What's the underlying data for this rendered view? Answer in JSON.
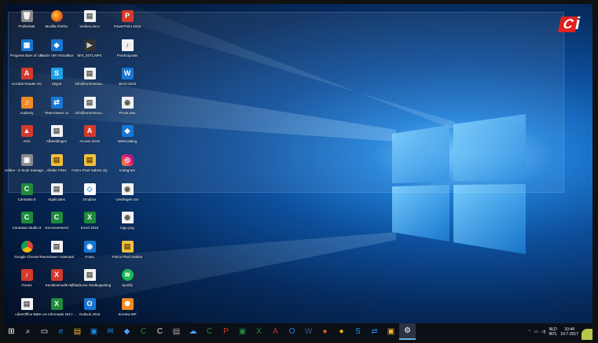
{
  "desktop": {
    "icons": [
      {
        "label": "Prullenbak",
        "glyph": "🗑",
        "cls": "g-gray"
      },
      {
        "label": "Progress Bars of Life",
        "glyph": "▦",
        "cls": "g-blue"
      },
      {
        "label": "Acrobat Reader DC",
        "glyph": "A",
        "cls": "g-red"
      },
      {
        "label": "Audacity",
        "glyph": "♫",
        "cls": "g-orange"
      },
      {
        "label": "AVG",
        "glyph": "▲",
        "cls": "g-red"
      },
      {
        "label": "calibre - E-book management",
        "glyph": "▣",
        "cls": "g-gray"
      },
      {
        "label": "Camtasia 8",
        "glyph": "C",
        "cls": "g-green"
      },
      {
        "label": "Camtasia Studio 8",
        "glyph": "C",
        "cls": "g-green"
      },
      {
        "label": "Google Chrome",
        "glyph": "",
        "cls": "g-chrome"
      },
      {
        "label": "iTunes",
        "glyph": "♪",
        "cls": "g-red"
      },
      {
        "label": "LibreOffice 5.3",
        "glyph": "▤",
        "cls": "g-doc"
      },
      {
        "label": "Mozilla Firefox",
        "glyph": "",
        "cls": "g-ff"
      },
      {
        "label": "Oracle VM VirtualBox",
        "glyph": "◆",
        "cls": "g-blue"
      },
      {
        "label": "Skype",
        "glyph": "S",
        "cls": "g-cyan"
      },
      {
        "label": "TeamViewer 11",
        "glyph": "⇄",
        "cls": "g-blue"
      },
      {
        "label": "Afbeeldingen",
        "glyph": "▤",
        "cls": "g-doc"
      },
      {
        "label": "Alleike Films",
        "glyph": "▤",
        "cls": "g-zip"
      },
      {
        "label": "Applicaties",
        "glyph": "▤",
        "cls": "g-doc"
      },
      {
        "label": "Geconverteerd",
        "glyph": "C",
        "cls": "g-green"
      },
      {
        "label": "Teamviewer materiaal",
        "glyph": "▤",
        "cls": "g-doc"
      },
      {
        "label": "Kerstlesmodle",
        "glyph": "X",
        "cls": "g-red"
      },
      {
        "label": "Uren en Informatie 2017.xlsx",
        "glyph": "X",
        "cls": "g-green"
      },
      {
        "label": "Verkies.docx",
        "glyph": "▤",
        "cls": "g-doc"
      },
      {
        "label": "MVI_0371.MP4",
        "glyph": "▶",
        "cls": "g-film"
      },
      {
        "label": "info@torrsmeout...",
        "glyph": "▤",
        "cls": "g-doc"
      },
      {
        "label": "info@torrsmeout...",
        "glyph": "▤",
        "cls": "g-doc"
      },
      {
        "label": "Access 2016",
        "glyph": "A",
        "cls": "g-red"
      },
      {
        "label": "Foto's Pixel Sabine.zip",
        "glyph": "▤",
        "cls": "g-zip"
      },
      {
        "label": "Dropbox",
        "glyph": "◇",
        "cls": "g-dbox"
      },
      {
        "label": "Excel 2016",
        "glyph": "X",
        "cls": "g-green"
      },
      {
        "label": "Fotos",
        "glyph": "◉",
        "cls": "g-blue"
      },
      {
        "label": "HijfbladLeze Snelkoppeling",
        "glyph": "▤",
        "cls": "g-doc"
      },
      {
        "label": "Outlook 2016",
        "glyph": "O",
        "cls": "g-blue"
      },
      {
        "label": "PowerPoint 2016",
        "glyph": "P",
        "cls": "g-red"
      },
      {
        "label": "Practicig.wav",
        "glyph": "♪",
        "cls": "g-doc"
      },
      {
        "label": "Word 2016",
        "glyph": "W",
        "cls": "g-blue"
      },
      {
        "label": "Pizvie.wav",
        "glyph": "◉",
        "cls": "g-doc"
      },
      {
        "label": "WebCatalog",
        "glyph": "◆",
        "cls": "g-blue"
      },
      {
        "label": "Instagram",
        "glyph": "◎",
        "cls": "g-ig"
      },
      {
        "label": "Leerlingen.csv",
        "glyph": "◉",
        "cls": "g-doc"
      },
      {
        "label": "logo.png",
        "glyph": "◉",
        "cls": "g-doc"
      },
      {
        "label": "Foto's Pixel Sabine",
        "glyph": "▤",
        "cls": "g-zip"
      },
      {
        "label": "Spotify",
        "glyph": "≋",
        "cls": "g-spot"
      },
      {
        "label": "XnView MP",
        "glyph": "✺",
        "cls": "g-orange"
      }
    ]
  },
  "logo": {
    "c": "C",
    "i": "i"
  },
  "taskbar": {
    "apps": [
      {
        "name": "start",
        "glyph": "⊞",
        "color": "#ffffff"
      },
      {
        "name": "search",
        "glyph": "⌕",
        "color": "#ffffff"
      },
      {
        "name": "task-view",
        "glyph": "▭",
        "color": "#ffffff"
      },
      {
        "name": "edge",
        "glyph": "e",
        "color": "#1e88e5"
      },
      {
        "name": "explorer",
        "glyph": "▤",
        "color": "#f2b632"
      },
      {
        "name": "store",
        "glyph": "▣",
        "color": "#1e88e5"
      },
      {
        "name": "mail",
        "glyph": "✉",
        "color": "#1e88e5"
      },
      {
        "name": "app-blue",
        "glyph": "◆",
        "color": "#4aa3ff"
      },
      {
        "name": "app-green",
        "glyph": "C",
        "color": "#1e8b3a"
      },
      {
        "name": "app-white",
        "glyph": "C",
        "color": "#dddddd"
      },
      {
        "name": "app-doc",
        "glyph": "▤",
        "color": "#aaaaaa"
      },
      {
        "name": "app-cloud",
        "glyph": "☁",
        "color": "#4aa3ff"
      },
      {
        "name": "app-camtasia",
        "glyph": "C",
        "color": "#1e8b3a"
      },
      {
        "name": "app-powerpoint",
        "glyph": "P",
        "color": "#d33a2c"
      },
      {
        "name": "app-green2",
        "glyph": "▣",
        "color": "#1e8b3a"
      },
      {
        "name": "app-excel",
        "glyph": "X",
        "color": "#1e8b3a"
      },
      {
        "name": "app-access",
        "glyph": "A",
        "color": "#a4373a"
      },
      {
        "name": "app-outlook",
        "glyph": "O",
        "color": "#1e88e5"
      },
      {
        "name": "app-word",
        "glyph": "W",
        "color": "#2b579a"
      },
      {
        "name": "app-firefox",
        "glyph": "●",
        "color": "#e65e15"
      },
      {
        "name": "app-chrome",
        "glyph": "●",
        "color": "#f4b400"
      },
      {
        "name": "app-skype",
        "glyph": "S",
        "color": "#1ca1e8"
      },
      {
        "name": "app-teamviewer",
        "glyph": "⇄",
        "color": "#1e88e5"
      },
      {
        "name": "app-photo",
        "glyph": "▣",
        "color": "#f2b632"
      },
      {
        "name": "settings",
        "glyph": "⚙",
        "color": "#ffffff"
      }
    ],
    "tray": {
      "lang1": "NLD",
      "lang2": "INTL",
      "time": "10:44",
      "date": "10-7-2017"
    }
  }
}
